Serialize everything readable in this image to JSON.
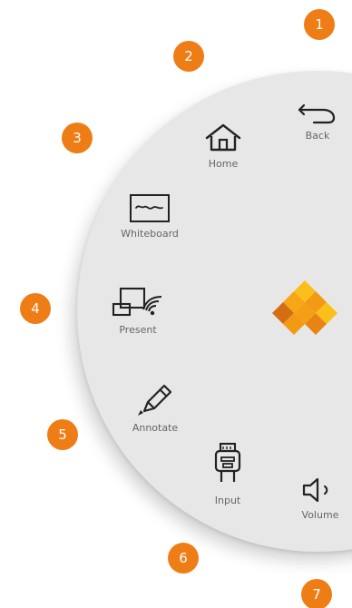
{
  "markers": [
    "1",
    "2",
    "3",
    "4",
    "5",
    "6",
    "7"
  ],
  "menu": {
    "back": {
      "label": "Back"
    },
    "home": {
      "label": "Home"
    },
    "whiteboard": {
      "label": "Whiteboard"
    },
    "present": {
      "label": "Present"
    },
    "annotate": {
      "label": "Annotate"
    },
    "input": {
      "label": "Input"
    },
    "volume": {
      "label": "Volume"
    }
  },
  "colors": {
    "accent": "#ef7d16",
    "wheel": "#e7e7e7",
    "label": "#666666",
    "icon": "#222222",
    "logo_light": "#fbbf1a",
    "logo_mid": "#f39a14",
    "logo_dark": "#d56d12"
  },
  "icons": {
    "back": "back-arrow-icon",
    "home": "home-icon",
    "whiteboard": "whiteboard-icon",
    "present": "present-icon",
    "annotate": "pen-icon",
    "input": "hdmi-plug-icon",
    "volume": "speaker-icon",
    "logo": "diamond-logo-icon"
  }
}
